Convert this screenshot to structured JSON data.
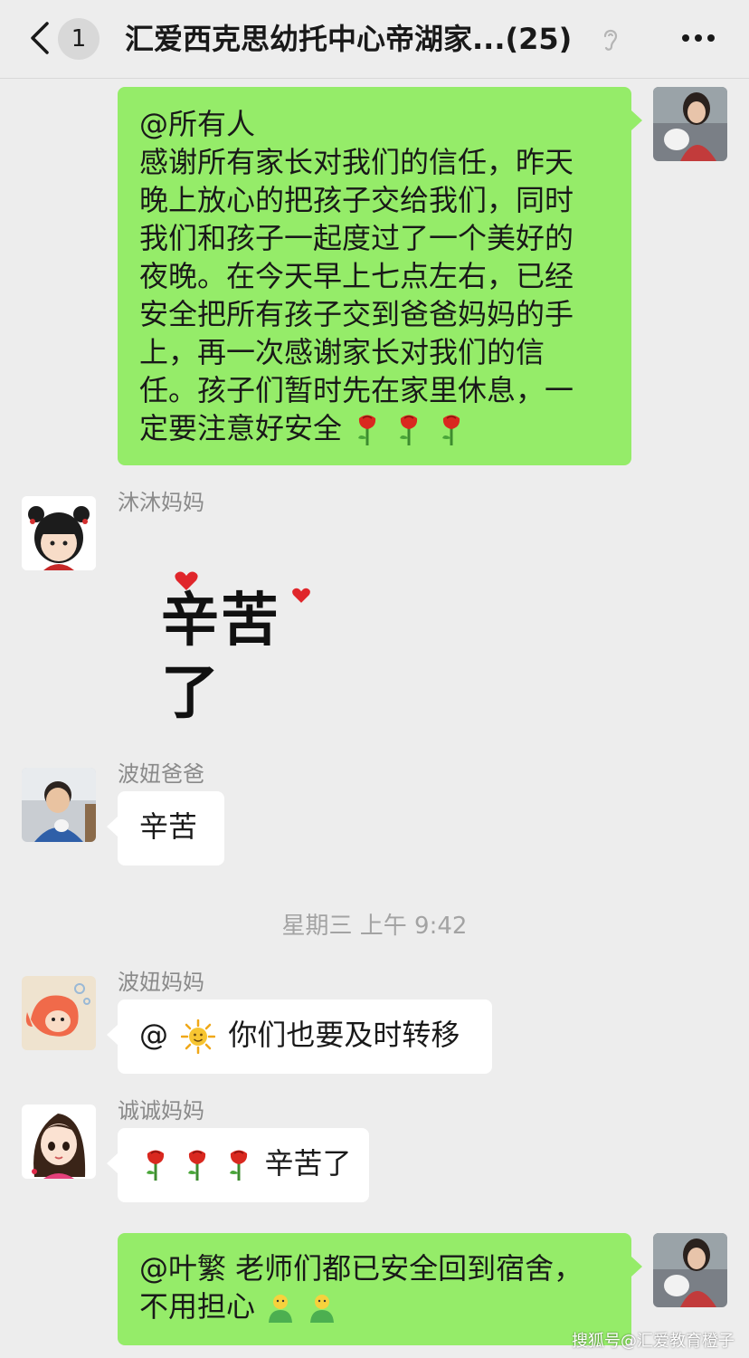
{
  "header": {
    "back_label": "<",
    "unread_count": "1",
    "title": "汇爱西克思幼托中心帝湖家...(25)"
  },
  "messages": [
    {
      "lines": [
        "@所有人",
        "感谢所有家长对我们的信任，昨天",
        "晚上放心的把孩子交给我们，同时",
        "我们和孩子一起度过了一个美好的",
        "夜晚。在今天早上七点左右，已经",
        "安全把所有孩子交到爸爸妈妈的手",
        "上，再一次感谢家长对我们的信",
        "任。孩子们暂时先在家里休息，一",
        "定要注意好安全"
      ]
    },
    {
      "sender": "沐沐妈妈",
      "sticker_text": "辛苦了"
    },
    {
      "sender": "波妞爸爸",
      "text": "辛苦"
    },
    {
      "sender": "波妞妈妈",
      "prefix": "@",
      "text": "你们也要及时转移"
    },
    {
      "sender": "诚诚妈妈",
      "text": "辛苦了"
    },
    {
      "lines": [
        "@叶繁 老师们都已安全回到宿舍，",
        "不用担心"
      ]
    }
  ],
  "timestamp": "星期三 上午 9:42",
  "watermark": "搜狐号@汇爱教育橙子",
  "colors": {
    "my_bubble": "#95ec69",
    "their_bubble": "#ffffff",
    "background": "#ededed"
  },
  "icons": [
    "back-icon",
    "ear-icon",
    "more-icon",
    "rose-emoji",
    "sun-emoji",
    "emoji-person"
  ]
}
